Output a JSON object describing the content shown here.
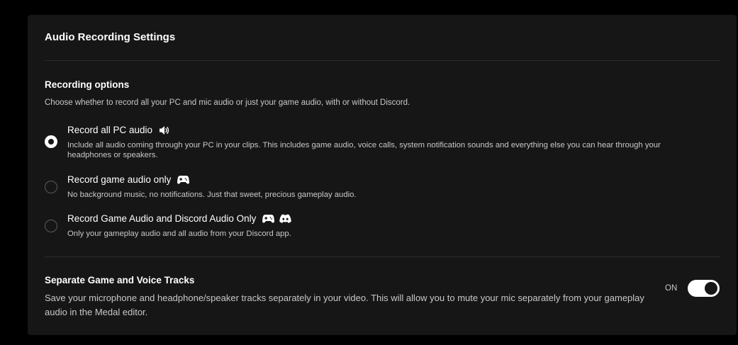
{
  "panel": {
    "title": "Audio Recording Settings"
  },
  "recording": {
    "title": "Recording options",
    "description": "Choose whether to record all your PC and mic audio or just your game audio, with or without Discord.",
    "options": [
      {
        "label": "Record all PC audio",
        "description": "Include all audio coming through your PC in your clips. This includes game audio, voice calls, system notification sounds and everything else you can hear through your headphones or speakers.",
        "icons": [
          "speaker-icon"
        ],
        "selected": true
      },
      {
        "label": "Record game audio only",
        "description": "No background music, no notifications. Just that sweet, precious gameplay audio.",
        "icons": [
          "gamepad-icon"
        ],
        "selected": false
      },
      {
        "label": "Record Game Audio and Discord Audio Only",
        "description": "Only your gameplay audio and all audio from your Discord app.",
        "icons": [
          "gamepad-icon",
          "discord-icon"
        ],
        "selected": false
      }
    ]
  },
  "separate_tracks": {
    "title": "Separate Game and Voice Tracks",
    "description": "Save your microphone and headphone/speaker tracks separately in your video. This will allow you to mute your mic separately from your gameplay audio in the Medal editor.",
    "state_label": "ON",
    "enabled": true
  },
  "colors": {
    "background": "#000000",
    "panel": "#161616",
    "text_primary": "#ffffff",
    "text_secondary": "#c8c8c8",
    "divider": "#2c2c2c",
    "radio_border": "#5a5a5a"
  }
}
